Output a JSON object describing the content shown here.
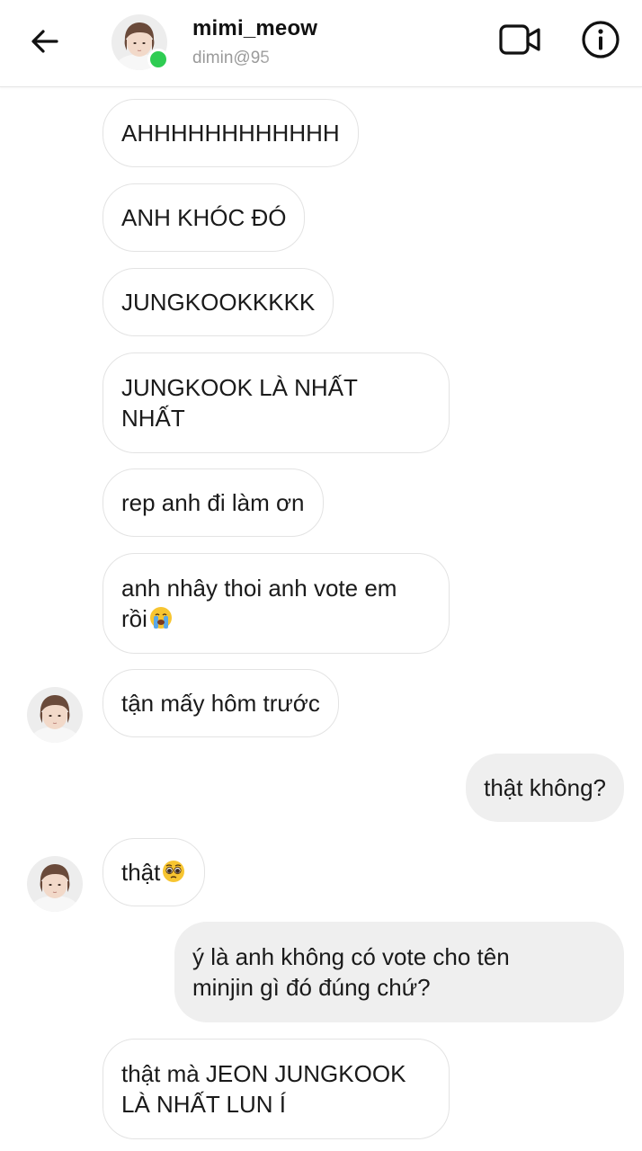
{
  "header": {
    "username": "mimi_meow",
    "handle": "dimin@95",
    "online": true
  },
  "messages": [
    {
      "side": "in",
      "text": "AHHHHHHHHHHHH"
    },
    {
      "side": "in",
      "text": "ANH KHÓC ĐÓ"
    },
    {
      "side": "in",
      "text": "JUNGKOOKKKKK"
    },
    {
      "side": "in",
      "text": "JUNGKOOK LÀ NHẤT\nNHẤT"
    },
    {
      "side": "in",
      "text": "rep anh đi làm ơn"
    },
    {
      "side": "in",
      "text": "anh nhây thoi anh vote em\nrồi",
      "emoji": "crying-face"
    },
    {
      "side": "in",
      "text": "tận mấy hôm trước",
      "show_avatar": true
    },
    {
      "side": "out",
      "text": "thật không?"
    },
    {
      "side": "in",
      "text": "thật",
      "emoji": "pleading-face",
      "show_avatar": true
    },
    {
      "side": "out",
      "text": "ý là anh không có vote cho tên\nminjin gì đó đúng chứ?"
    },
    {
      "side": "in",
      "text": "thật mà JEON JUNGKOOK\nLÀ NHẤT LUN Í"
    }
  ],
  "colors": {
    "online_dot": "#2ecc52",
    "incoming_bubble_bg": "#ffffff",
    "incoming_bubble_border": "#e3e3e3",
    "outgoing_bubble_bg": "#efefef",
    "text": "#1a1a1a",
    "handle_text": "#9a9a9a"
  },
  "icons": {
    "back": "arrow-left-icon",
    "video_call": "video-camera-icon",
    "info": "info-circle-icon"
  }
}
